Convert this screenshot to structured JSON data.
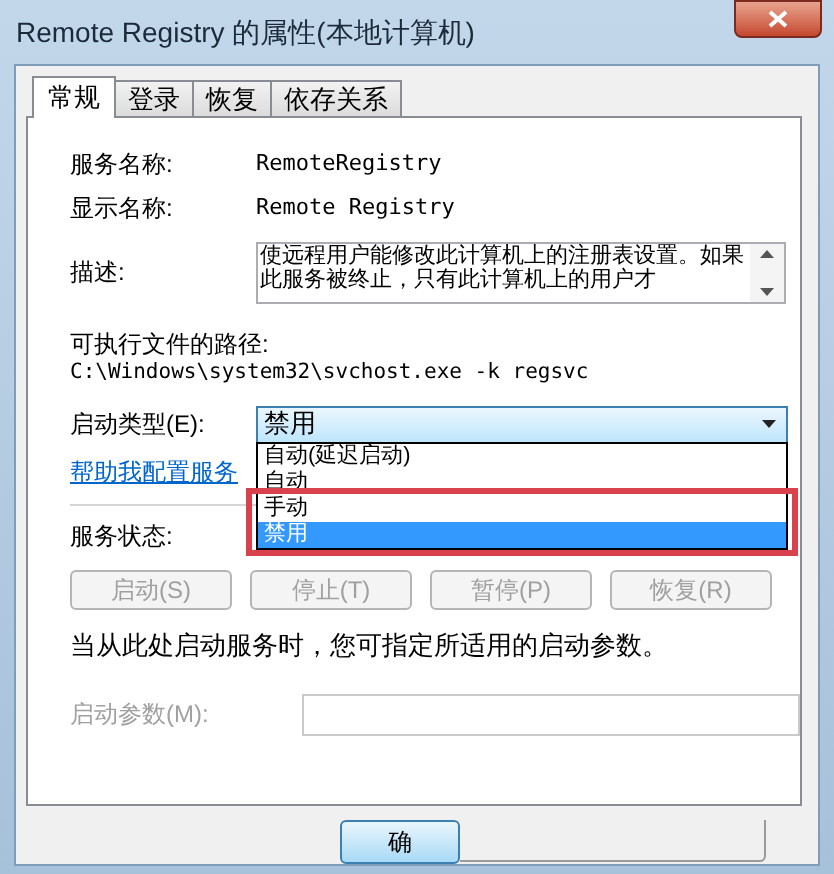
{
  "window": {
    "title": "Remote Registry 的属性(本地计算机)"
  },
  "tabs": [
    {
      "label": "常规",
      "selected": true
    },
    {
      "label": "登录",
      "selected": false
    },
    {
      "label": "恢复",
      "selected": false
    },
    {
      "label": "依存关系",
      "selected": false
    }
  ],
  "service_name": {
    "label": "服务名称:",
    "value": "RemoteRegistry"
  },
  "display_name": {
    "label": "显示名称:",
    "value": "Remote Registry"
  },
  "description": {
    "label": "描述:",
    "value": "使远程用户能修改此计算机上的注册表设置。如果此服务被终止，只有此计算机上的用户才"
  },
  "path": {
    "label": "可执行文件的路径:",
    "value": "C:\\Windows\\system32\\svchost.exe -k regsvc"
  },
  "startup_type": {
    "label": "启动类型(E):",
    "value": "禁用",
    "expanded": true,
    "options": [
      {
        "label": "自动(延迟启动)",
        "selected": false
      },
      {
        "label": "自动",
        "selected": false
      },
      {
        "label": "手动",
        "selected": false
      },
      {
        "label": "禁用",
        "selected": true
      }
    ]
  },
  "help_link": "帮助我配置服务",
  "service_status": {
    "label": "服务状态:"
  },
  "control_buttons": [
    {
      "label": "启动(S)",
      "disabled": true
    },
    {
      "label": "停止(T)",
      "disabled": true
    },
    {
      "label": "暂停(P)",
      "disabled": true
    },
    {
      "label": "恢复(R)",
      "disabled": true
    }
  ],
  "note": "当从此处启动服务时，您可指定所适用的启动参数。",
  "start_parameters": {
    "label": "启动参数(M):",
    "disabled": true
  },
  "ok_button": "确"
}
